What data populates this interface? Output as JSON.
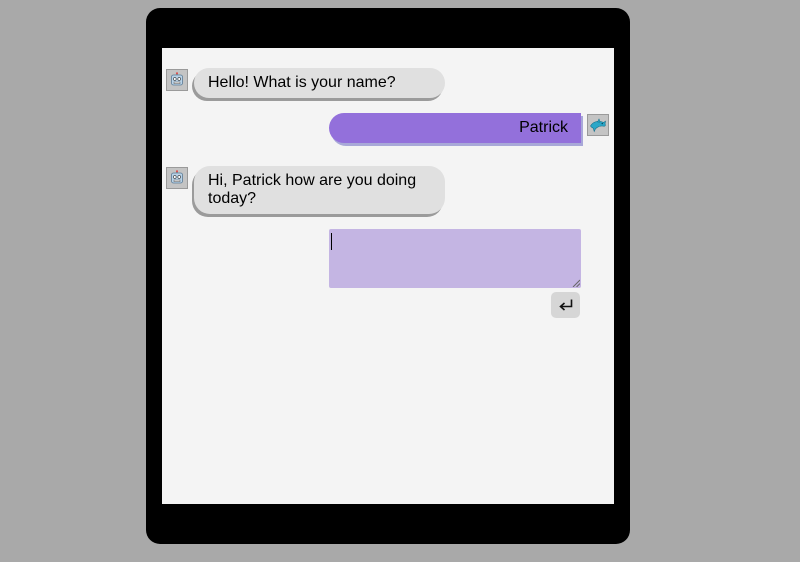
{
  "conversation": {
    "messages": [
      {
        "sender": "bot",
        "text": "Hello! What is your name?"
      },
      {
        "sender": "user",
        "text": "Patrick"
      },
      {
        "sender": "bot",
        "text": "Hi, Patrick how are you doing today?"
      }
    ]
  },
  "composer": {
    "value": "",
    "send_icon": "return-arrow-icon"
  },
  "avatars": {
    "bot_icon": "robot-icon",
    "user_icon": "dolphin-icon"
  },
  "colors": {
    "page_background": "#a9a9a9",
    "device_frame": "#000000",
    "screen_background": "#f4f4f4",
    "bot_bubble": "#e0e0e0",
    "user_bubble": "#9370db",
    "composer_background": "#c4b5e3",
    "send_button": "#d6d6d6"
  }
}
